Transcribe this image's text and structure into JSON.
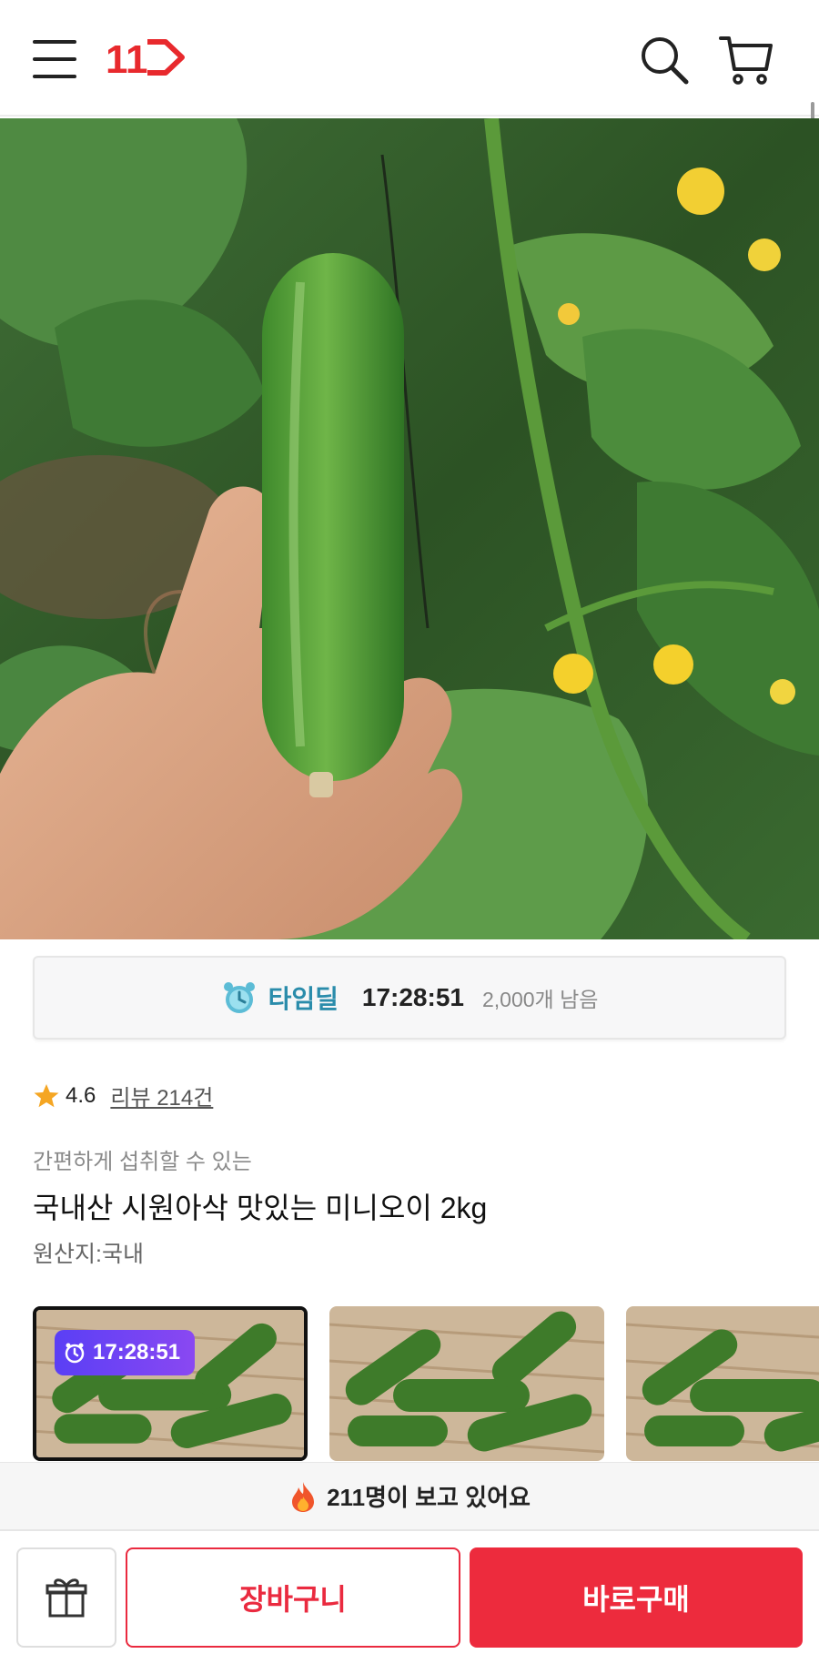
{
  "header": {
    "logo_text": "11",
    "icons": {
      "menu": "hamburger-menu-icon",
      "search": "search-icon",
      "cart": "cart-icon"
    },
    "brand_color": "#e8292d"
  },
  "hero": {
    "image_alt": "cucumber-on-vine-photo",
    "carousel": {
      "total": 4,
      "active_index": 4
    }
  },
  "timedeal": {
    "label": "타임딜",
    "time": "17:28:51",
    "remaining": "2,000개 남음",
    "label_color": "#2a8cab"
  },
  "rating": {
    "score": "4.6",
    "review_link": "리뷰 214건",
    "star_color": "#f5a623"
  },
  "product": {
    "subtitle": "간편하게 섭취할 수 있는",
    "title": "국내산 시원아삭 맛있는 미니오이 2kg",
    "origin": "원산지:국내"
  },
  "options": {
    "badge_time": "17:28:51",
    "selected_index": 0
  },
  "viewers": {
    "text": "211명이 보고 있어요"
  },
  "actions": {
    "cart_label": "장바구니",
    "buy_label": "바로구매",
    "accent_color": "#ed2b3d"
  }
}
